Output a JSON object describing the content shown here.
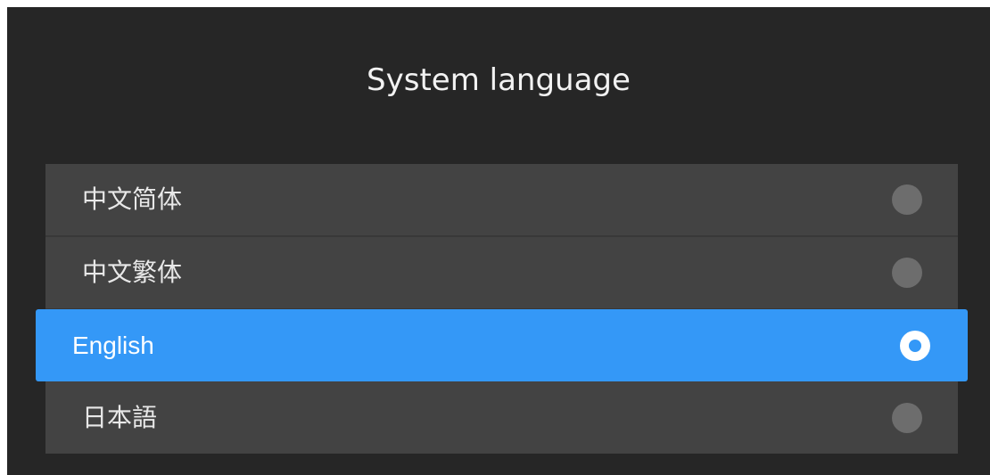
{
  "header": {
    "title": "System language"
  },
  "languages": [
    {
      "label": "中文简体",
      "selected": false
    },
    {
      "label": "中文繁体",
      "selected": false
    },
    {
      "label": "English",
      "selected": true
    },
    {
      "label": "日本語",
      "selected": false
    }
  ],
  "colors": {
    "background": "#262626",
    "row": "#434343",
    "accent": "#3498f7",
    "radio_off": "#6d6d6d",
    "text": "#e8e8e8"
  },
  "icons": {
    "radio_off": "radio-unselected-icon",
    "radio_on": "radio-selected-icon"
  }
}
